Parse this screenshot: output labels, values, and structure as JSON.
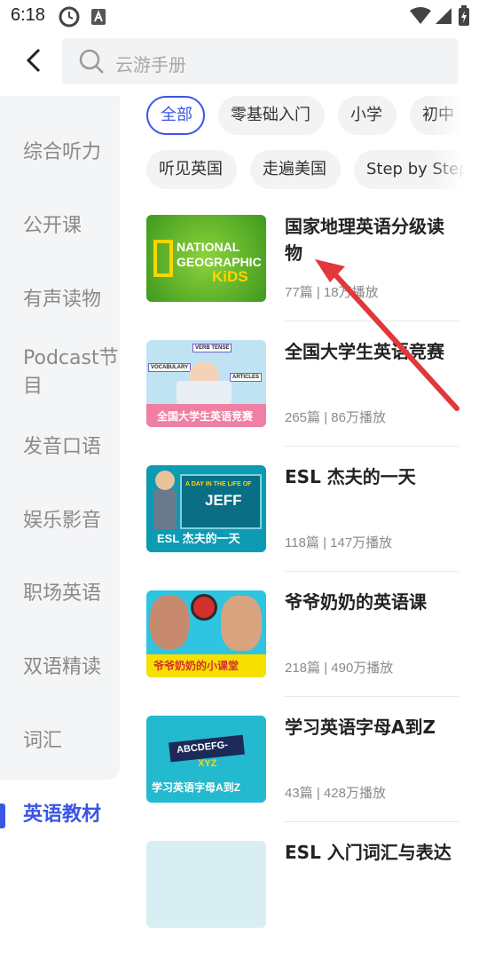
{
  "status": {
    "time": "6:18"
  },
  "search": {
    "placeholder": "云游手册"
  },
  "sidebar": {
    "items": [
      {
        "label": "综合听力"
      },
      {
        "label": "公开课"
      },
      {
        "label": "有声读物"
      },
      {
        "label": "Podcast节目"
      },
      {
        "label": "发音口语"
      },
      {
        "label": "娱乐影音"
      },
      {
        "label": "职场英语"
      },
      {
        "label": "双语精读"
      },
      {
        "label": "词汇"
      },
      {
        "label": "英语教材"
      }
    ],
    "active_index": 9
  },
  "filters": {
    "row1": [
      "全部",
      "零基础入门",
      "小学",
      "初中"
    ],
    "row2": [
      "听见英国",
      "走遍美国",
      "Step by Step"
    ],
    "active": "全部"
  },
  "list": [
    {
      "title": "国家地理英语分级读物",
      "meta": "77篇 | 18万播放",
      "thumb": {
        "line1": "NATIONAL",
        "line2": "GEOGRAPHIC",
        "line3": "KiDS"
      }
    },
    {
      "title": "全国大学生英语竞赛",
      "meta": "265篇 | 86万播放",
      "thumb": {
        "tag1": "VERB TENSE",
        "tag2": "VOCABULARY",
        "tag3": "ARTICLES",
        "banner": "全国大学生英语竞赛"
      }
    },
    {
      "title": "ESL 杰夫的一天",
      "meta": "118篇 | 147万播放",
      "thumb": {
        "line1": "A DAY IN THE LIFE OF",
        "line2": "JEFF",
        "banner": "ESL 杰夫的一天"
      }
    },
    {
      "title": "爷爷奶奶的英语课",
      "meta": "218篇 | 490万播放",
      "thumb": {
        "banner": "爷爷奶奶的小课堂"
      }
    },
    {
      "title": "学习英语字母A到Z",
      "meta": "43篇 | 428万播放",
      "thumb": {
        "line1": "ABCDEFG-",
        "line2": "XYZ",
        "banner": "学习英语字母A到Z"
      }
    },
    {
      "title": "ESL 入门词汇与表达",
      "meta": "",
      "thumb": {}
    }
  ],
  "colors": {
    "accent": "#3b55e6",
    "arrow": "#e0383b"
  }
}
